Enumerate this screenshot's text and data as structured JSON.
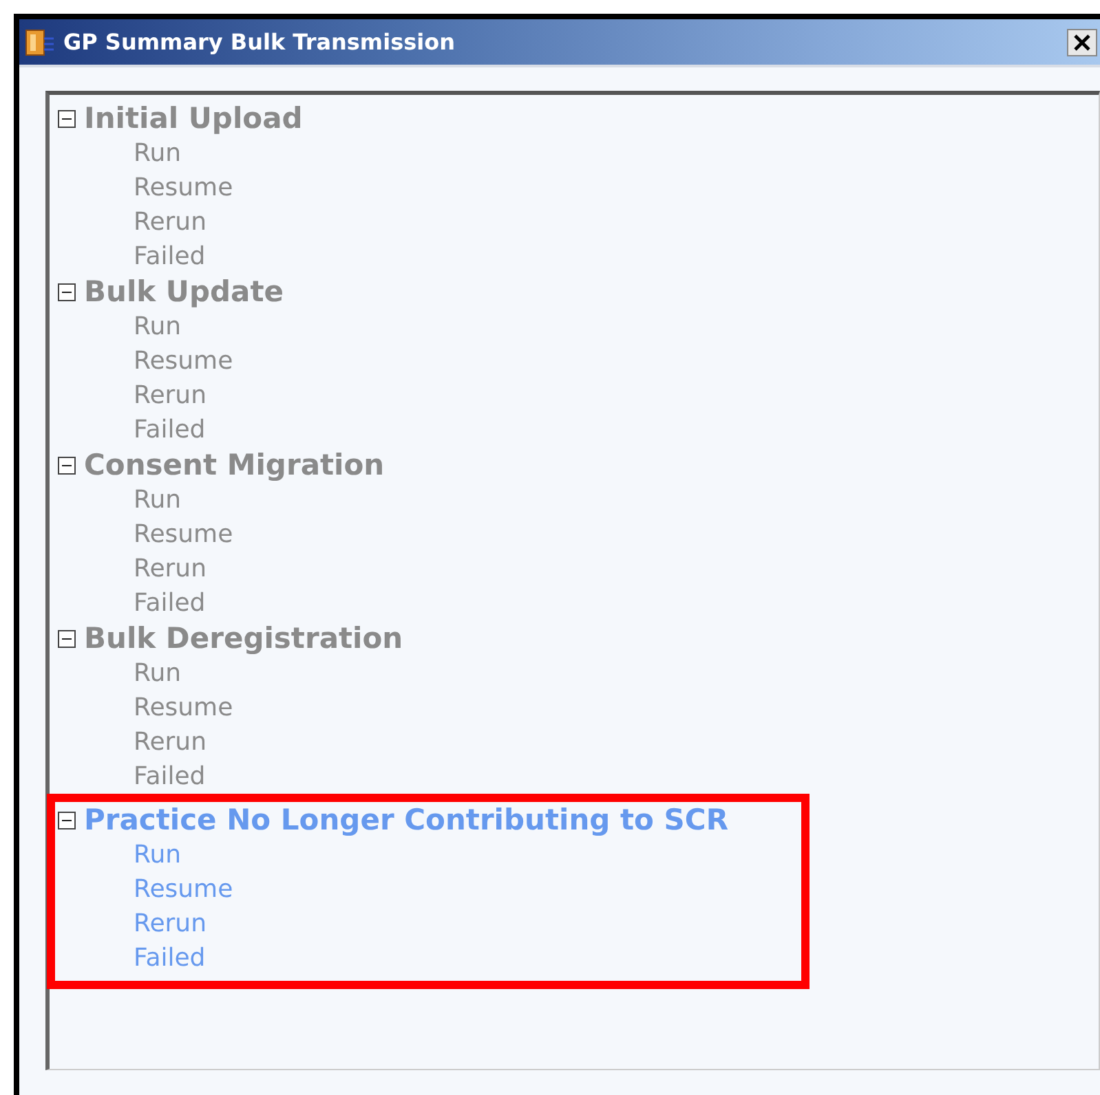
{
  "window": {
    "title": "GP Summary Bulk Transmission"
  },
  "tree": [
    {
      "label": "Initial Upload",
      "expanded": true,
      "selected": false,
      "children": [
        {
          "label": "Run"
        },
        {
          "label": "Resume"
        },
        {
          "label": "Rerun"
        },
        {
          "label": "Failed"
        }
      ]
    },
    {
      "label": "Bulk Update",
      "expanded": true,
      "selected": false,
      "children": [
        {
          "label": "Run"
        },
        {
          "label": "Resume"
        },
        {
          "label": "Rerun"
        },
        {
          "label": "Failed"
        }
      ]
    },
    {
      "label": "Consent Migration",
      "expanded": true,
      "selected": false,
      "children": [
        {
          "label": "Run"
        },
        {
          "label": "Resume"
        },
        {
          "label": "Rerun"
        },
        {
          "label": "Failed"
        }
      ]
    },
    {
      "label": "Bulk Deregistration",
      "expanded": true,
      "selected": false,
      "children": [
        {
          "label": "Run"
        },
        {
          "label": "Resume"
        },
        {
          "label": "Rerun"
        },
        {
          "label": "Failed"
        }
      ]
    },
    {
      "label": "Practice No Longer Contributing to SCR",
      "expanded": true,
      "selected": true,
      "children": [
        {
          "label": "Run"
        },
        {
          "label": "Resume"
        },
        {
          "label": "Rerun"
        },
        {
          "label": "Failed"
        }
      ]
    }
  ]
}
